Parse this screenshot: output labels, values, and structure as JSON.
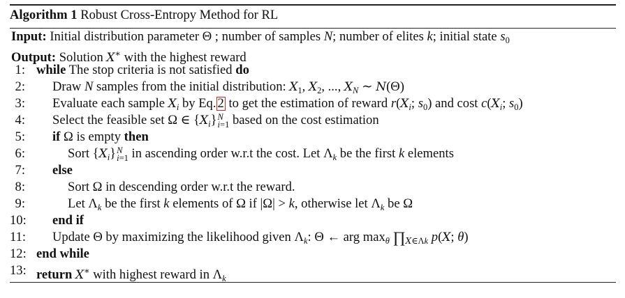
{
  "algorithm": {
    "label": "Algorithm 1",
    "title": "Robust Cross-Entropy Method for RL",
    "input_label": "Input:",
    "output_label": "Output:",
    "lines": [
      {
        "num": "1:"
      },
      {
        "num": "2:"
      },
      {
        "num": "3:"
      },
      {
        "num": "4:"
      },
      {
        "num": "5:"
      },
      {
        "num": "6:"
      },
      {
        "num": "7:"
      },
      {
        "num": "8:"
      },
      {
        "num": "9:"
      },
      {
        "num": "10:"
      },
      {
        "num": "11:"
      },
      {
        "num": "12:"
      },
      {
        "num": "13:"
      }
    ],
    "keywords": {
      "while": "while",
      "do": "do",
      "if": "if",
      "then": "then",
      "else": "else",
      "end_if": "end if",
      "end_while": "end while",
      "return": "return"
    },
    "eq_ref": "2",
    "colors": {
      "reference_box": "#e0201c",
      "text": "#111111"
    }
  }
}
